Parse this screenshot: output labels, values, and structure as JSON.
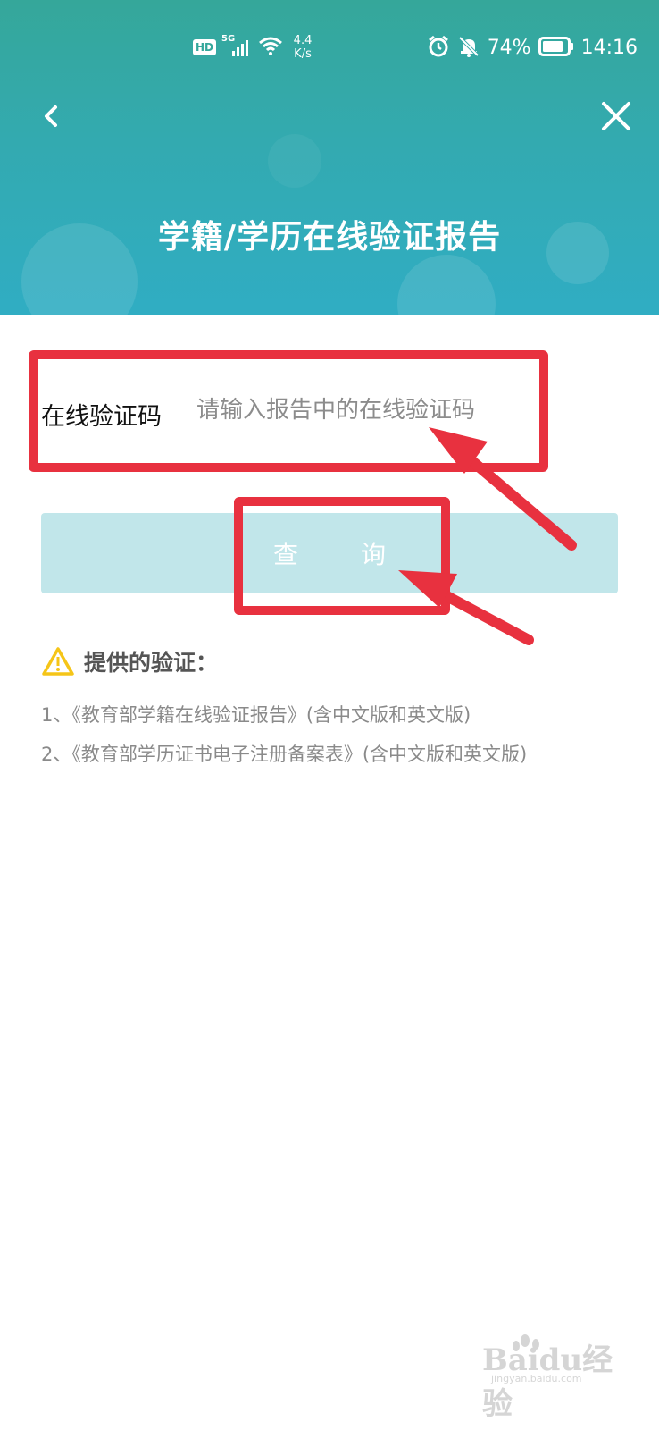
{
  "status_bar": {
    "hd": "HD",
    "network": "5G",
    "speed_value": "4.4",
    "speed_unit": "K/s",
    "battery": "74%",
    "time": "14:16"
  },
  "nav": {
    "back_icon": "chevron-left-icon",
    "close_icon": "close-icon"
  },
  "page": {
    "title": "学籍/学历在线验证报告"
  },
  "form": {
    "label": "在线验证码",
    "placeholder": "请输入报告中的在线验证码",
    "value": ""
  },
  "query_button": {
    "label": "查询"
  },
  "info": {
    "heading": "提供的验证：",
    "icon": "warning-icon",
    "items": [
      "1、《教育部学籍在线验证报告》(含中文版和英文版)",
      "2、《教育部学历证书电子注册备案表》(含中文版和英文版)"
    ]
  },
  "watermark": {
    "brand": "Baidu经验",
    "domain": "jingyan.baidu.com"
  },
  "colors": {
    "header": "#33aab0",
    "button": "#c1e6ea",
    "annotation": "#e8313f",
    "warning": "#f5c518"
  }
}
